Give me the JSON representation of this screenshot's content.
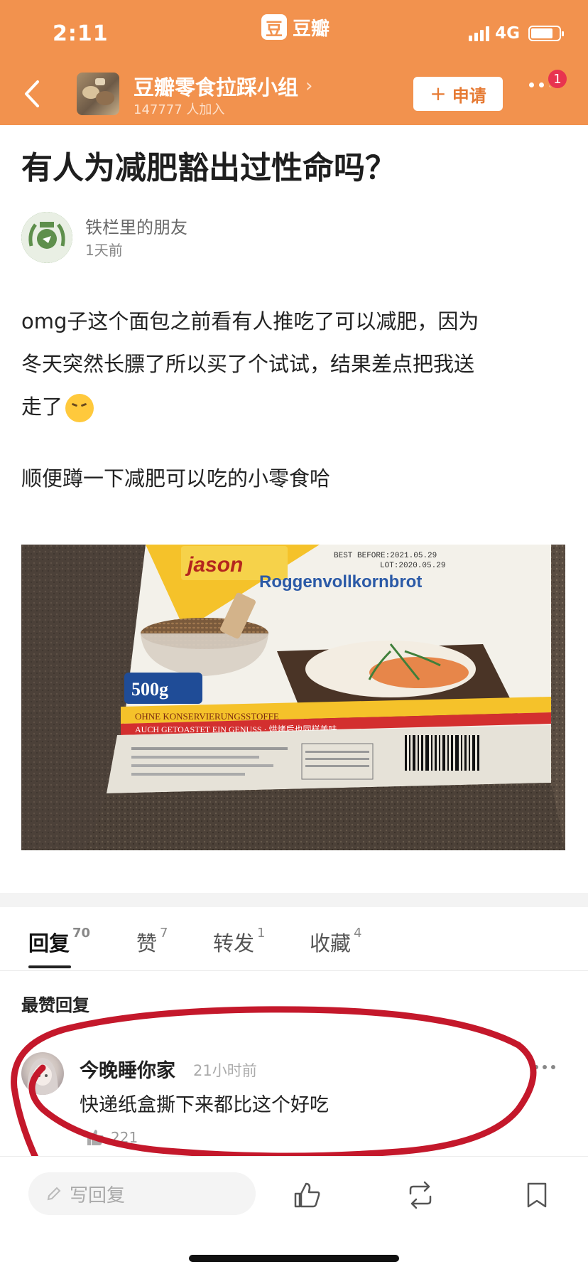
{
  "status_bar": {
    "time": "2:11",
    "network": "4G",
    "app_name": "豆瓣",
    "app_logo": "豆"
  },
  "group": {
    "name": "豆瓣零食拉踩小组",
    "members": "147777 人加入",
    "apply_label": "申请",
    "badge_count": "1"
  },
  "post": {
    "title": "有人为减肥豁出过性命吗？",
    "author": "铁栏里的朋友",
    "time": "1天前",
    "body_lines": [
      "omg子这个面包之前看有人推吃了可以减肥，因为",
      "冬天突然长膘了所以买了个试试，结果差点把我送",
      "走了"
    ],
    "body_extra": "顺便蹲一下减肥可以吃的小零食哈",
    "image": {
      "brand": "jason",
      "product": "Roggenvollkornbrot",
      "weight": "500g",
      "banner1": "OHNE KONSERVIERUNGSSTOFFE",
      "banner2": "AUCH GETOASTET EIN GENUSS · 烘烤后也同样美味",
      "best_before": "BEST BEFORE:2021.05.29",
      "lot": "LOT:2020.05.29"
    }
  },
  "tabs": [
    {
      "label": "回复",
      "count": "70"
    },
    {
      "label": "赞",
      "count": "7"
    },
    {
      "label": "转发",
      "count": "1"
    },
    {
      "label": "收藏",
      "count": "4"
    }
  ],
  "section_heading": "最赞回复",
  "comment": {
    "user": "今晚睡你家",
    "time": "21小时前",
    "text": "快递纸盒撕下来都比这个好吃",
    "likes": "221"
  },
  "bottom_bar": {
    "reply_placeholder": "写回复"
  },
  "colors": {
    "header": "#f2924e",
    "annotation": "#c4182b",
    "badge": "#e8334f"
  },
  "icons": [
    "back-icon",
    "chevron-right-icon",
    "plus-icon",
    "more-icon",
    "emoji-icon",
    "thumbs-up-icon",
    "repost-icon",
    "bookmark-icon",
    "pencil-icon"
  ]
}
